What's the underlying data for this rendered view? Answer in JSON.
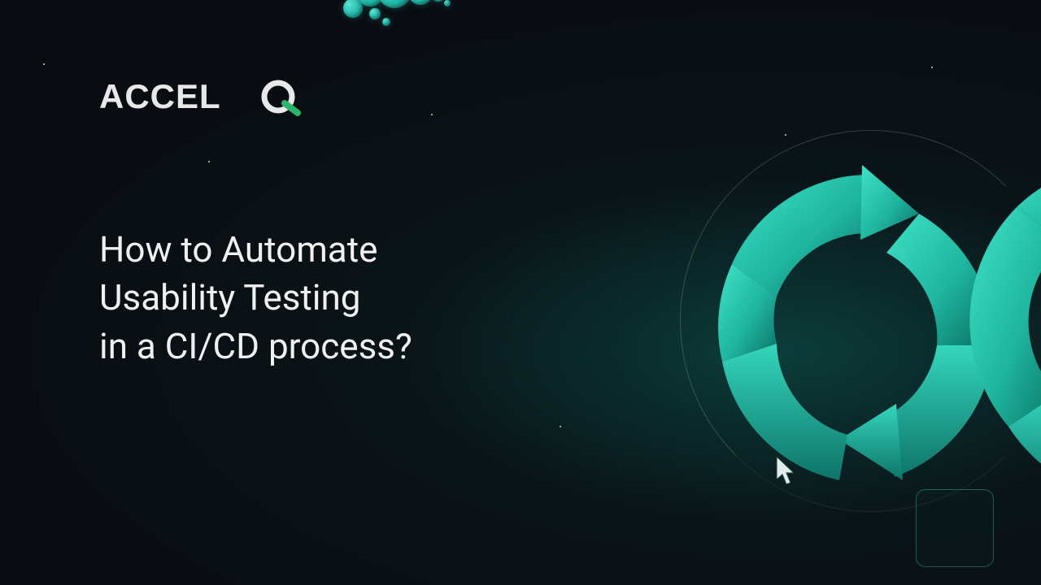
{
  "brand": {
    "name": "ACCELQ"
  },
  "headline": "How to Automate\nUsability Testing\nin a CI/CD process?",
  "colors": {
    "accent": "#2fd5b9",
    "background": "#090d12"
  }
}
